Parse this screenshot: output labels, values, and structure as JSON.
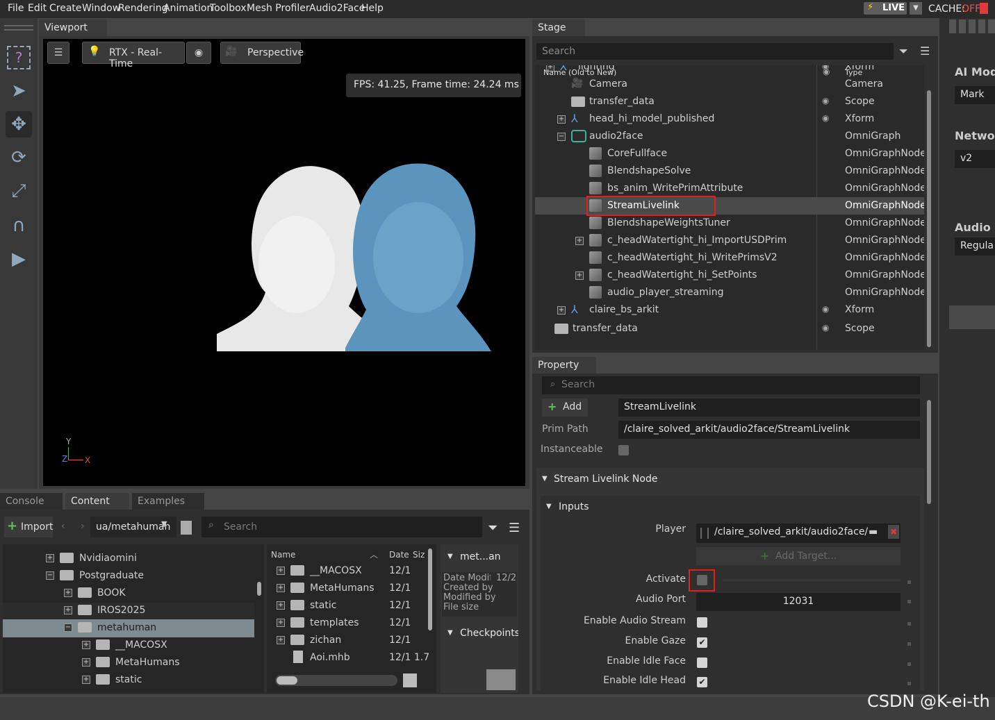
{
  "menu": [
    "File",
    "Edit",
    "Create",
    "Window",
    "Rendering",
    "Animation",
    "Toolbox",
    "Mesh Profiler",
    "Audio2Face",
    "Help"
  ],
  "status": {
    "live": "LIVE",
    "cache": "CACHE:",
    "cache_state": "OFF"
  },
  "viewport": {
    "tab": "Viewport",
    "renderer": "RTX - Real-Time",
    "camera": "Perspective",
    "fps": "FPS: 41.25, Frame time: 24.24 ms",
    "axis_y": "Y",
    "axis_x": "X",
    "axis_z": "Z"
  },
  "stage": {
    "tab": "Stage",
    "search_placeholder": "Search",
    "col_name": "Name (Old to New)",
    "col_type": "Type",
    "rows": [
      {
        "name": "lighting",
        "type": "Xform"
      },
      {
        "name": "Camera",
        "type": "Camera"
      },
      {
        "name": "transfer_data",
        "type": "Scope"
      },
      {
        "name": "head_hi_model_published",
        "type": "Xform"
      },
      {
        "name": "audio2face",
        "type": "OmniGraph"
      },
      {
        "name": "CoreFullface",
        "type": "OmniGraphNode"
      },
      {
        "name": "BlendshapeSolve",
        "type": "OmniGraphNode"
      },
      {
        "name": "bs_anim_WritePrimAttribute",
        "type": "OmniGraphNode"
      },
      {
        "name": "StreamLivelink",
        "type": "OmniGraphNode"
      },
      {
        "name": "BlendshapeWeightsTuner",
        "type": "OmniGraphNode"
      },
      {
        "name": "c_headWatertight_hi_ImportUSDPrim",
        "type": "OmniGraphNode"
      },
      {
        "name": "c_headWatertight_hi_WritePrimsV2",
        "type": "OmniGraphNode"
      },
      {
        "name": "c_headWatertight_hi_SetPoints",
        "type": "OmniGraphNode"
      },
      {
        "name": "audio_player_streaming",
        "type": "OmniGraphNode"
      },
      {
        "name": "claire_bs_arkit",
        "type": "Xform"
      },
      {
        "name": "transfer_data",
        "type": "Scope"
      }
    ]
  },
  "property": {
    "tab": "Property",
    "search_placeholder": "Search",
    "add": "Add",
    "name_value": "StreamLivelink",
    "prim_path_label": "Prim Path",
    "prim_path": "/claire_solved_arkit/audio2face/StreamLivelink",
    "instanceable_label": "Instanceable",
    "section": "Stream Livelink Node",
    "inputs": "Inputs",
    "player_label": "Player",
    "player_value": "/claire_solved_arkit/audio2face/",
    "add_target": "Add Target...",
    "activate_label": "Activate",
    "audio_port_label": "Audio Port",
    "audio_port": "12031",
    "enable_audio_stream": "Enable Audio Stream",
    "enable_gaze": "Enable Gaze",
    "enable_idle_face": "Enable Idle Face",
    "enable_idle_head": "Enable Idle Head",
    "checks": {
      "instanceable": false,
      "activate": false,
      "audio_stream": false,
      "gaze": true,
      "idle_face": false,
      "idle_head": true
    }
  },
  "right_panel": {
    "ai_model": "AI Mod",
    "ai_value": "Mark",
    "network": "Netwo",
    "network_value": "v2",
    "audio": "Audio",
    "audio_value": "Regula"
  },
  "bottom": {
    "tabs": [
      "Console",
      "Content",
      "Examples"
    ],
    "import": "Import",
    "path": "ua/metahuman",
    "search_placeholder": "Search",
    "tree": [
      "Nvidiaomini",
      "Postgraduate",
      "BOOK",
      "IROS2025",
      "metahuman",
      "__MACOSX",
      "MetaHumans",
      "static"
    ],
    "cols": {
      "name": "Name",
      "date": "Date",
      "size": "Siz"
    },
    "files": [
      {
        "name": "__MACOSX",
        "date": "12/1"
      },
      {
        "name": "MetaHumans",
        "date": "12/1"
      },
      {
        "name": "static",
        "date": "12/1"
      },
      {
        "name": "templates",
        "date": "12/1"
      },
      {
        "name": "zichan",
        "date": "12/1"
      },
      {
        "name": "Aoi.mhb",
        "date": "12/1 1.7"
      }
    ],
    "detail_title": "met...an",
    "detail_lines": [
      "Date Modifie",
      "Created by",
      "Modified by",
      "File size"
    ],
    "detail_date": "12/2",
    "checkpoints": "Checkpoints"
  },
  "watermark": "CSDN @K-ei-th"
}
